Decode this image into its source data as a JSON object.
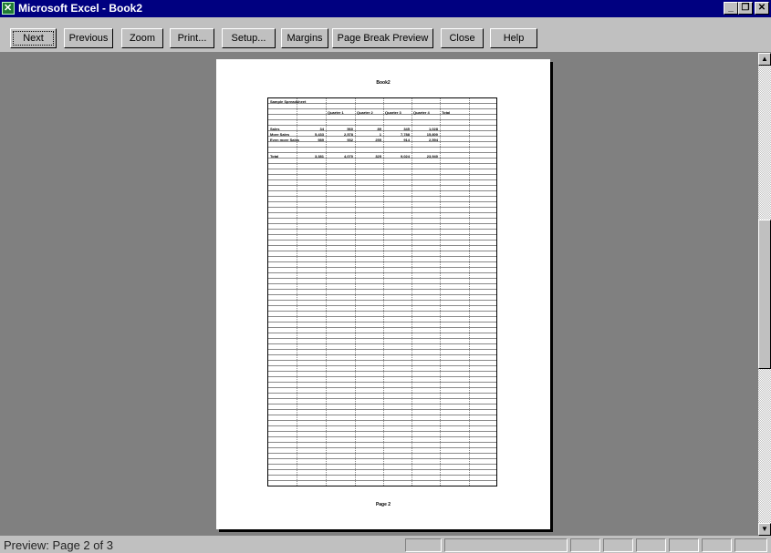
{
  "window": {
    "title": "Microsoft Excel - Book2"
  },
  "toolbar": {
    "next": "Next",
    "previous": "Previous",
    "zoom": "Zoom",
    "print": "Print...",
    "setup": "Setup...",
    "margins": "Margins",
    "page_break_preview": "Page Break Preview",
    "close": "Close",
    "help": "Help"
  },
  "page": {
    "header": "Book2",
    "footer": "Page 2",
    "title_cell": "Sample Spreadsheet",
    "columns": [
      "Quarter 1",
      "Quarter 2",
      "Quarter 3",
      "Quarter 4",
      "Total"
    ],
    "rows": [
      {
        "label": "Sales",
        "values": [
          "34",
          "560",
          "89",
          "345",
          "1,028"
        ]
      },
      {
        "label": "More Sales",
        "values": [
          "5,433",
          "2,578",
          "1",
          "7,788",
          "15,800"
        ]
      },
      {
        "label": "Even more Sales",
        "values": [
          "989",
          "932",
          "255",
          "914",
          "2,594"
        ]
      },
      {
        "label": "Total",
        "values": [
          "3,381",
          "4,070",
          "325",
          "9,024",
          "23,940"
        ]
      }
    ]
  },
  "status": {
    "text": "Preview: Page 2 of 3"
  },
  "icons": {
    "app": "excel-icon",
    "minimize": "minimize-icon",
    "restore": "restore-icon",
    "close": "close-icon"
  }
}
